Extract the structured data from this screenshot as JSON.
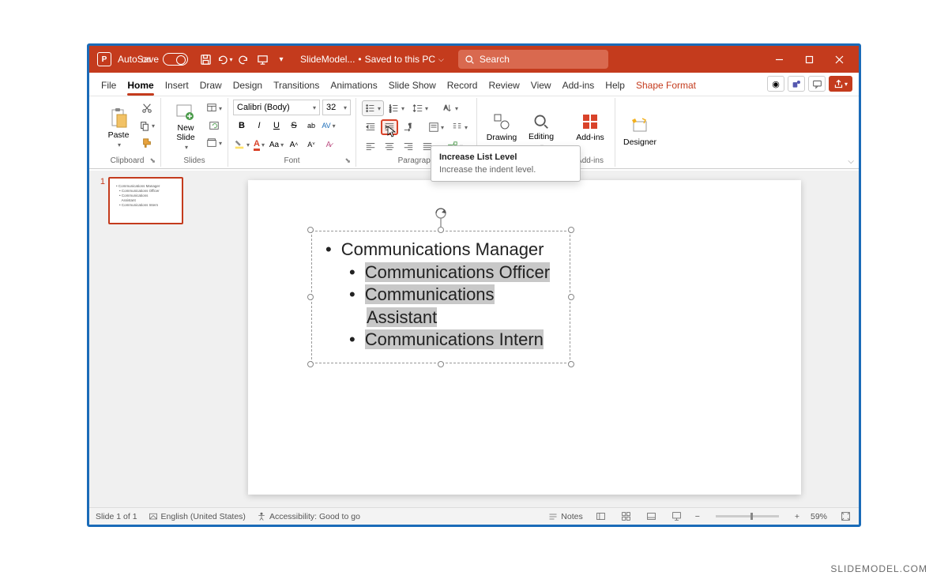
{
  "titlebar": {
    "autosave_label": "AutoSave",
    "autosave_state": "Off",
    "file_title": "SlideModel...",
    "saved_state": "Saved to this PC",
    "search_placeholder": "Search"
  },
  "tabs": {
    "file": "File",
    "home": "Home",
    "insert": "Insert",
    "draw": "Draw",
    "design": "Design",
    "transitions": "Transitions",
    "animations": "Animations",
    "slideshow": "Slide Show",
    "record": "Record",
    "review": "Review",
    "view": "View",
    "addins": "Add-ins",
    "help": "Help",
    "shapeformat": "Shape Format"
  },
  "ribbon": {
    "clipboard": {
      "paste": "Paste",
      "label": "Clipboard"
    },
    "slides": {
      "newslide": "New\nSlide",
      "label": "Slides"
    },
    "font": {
      "name": "Calibri (Body)",
      "size": "32",
      "label": "Font"
    },
    "paragraph": {
      "label": "Paragraph"
    },
    "drawing": {
      "label": "Drawing",
      "btn": "Drawing"
    },
    "editing": {
      "label": "Editing",
      "btn": "Editing"
    },
    "addins": {
      "label": "Add-ins",
      "btn": "Add-ins"
    },
    "designer": {
      "btn": "Designer"
    }
  },
  "tooltip": {
    "title": "Increase List Level",
    "desc": "Increase the indent level."
  },
  "slide_thumb_number": "1",
  "textbox_content": {
    "l1": "Communications Manager",
    "l2": "Communications Officer",
    "l3a": "Communications",
    "l3b": "Assistant",
    "l4": "Communications Intern"
  },
  "statusbar": {
    "slide_counter": "Slide 1 of 1",
    "language": "English (United States)",
    "accessibility": "Accessibility: Good to go",
    "notes": "Notes",
    "zoom": "59%"
  },
  "watermark": "SLIDEMODEL.COM"
}
